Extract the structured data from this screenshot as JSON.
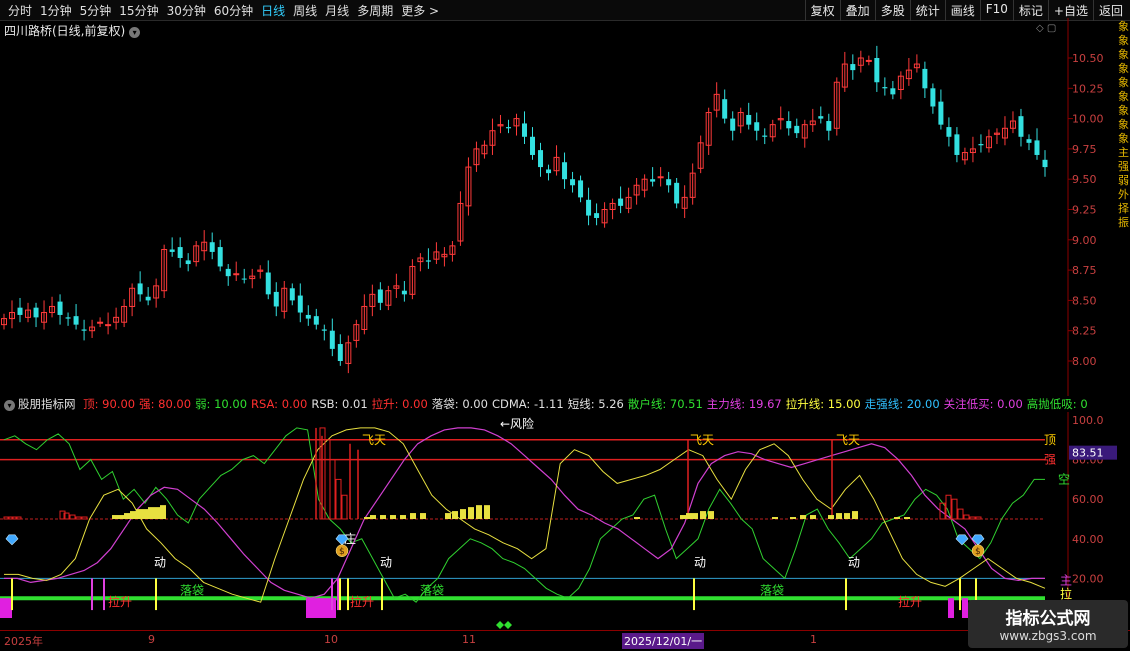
{
  "toolbar": {
    "periods": [
      "分时",
      "1分钟",
      "5分钟",
      "15分钟",
      "30分钟",
      "60分钟",
      "日线",
      "周线",
      "月线",
      "多周期",
      "更多 >"
    ],
    "active_period": "日线",
    "actions": [
      "复权",
      "叠加",
      "多股",
      "统计",
      "画线",
      "F10",
      "标记",
      "+自选",
      "返回"
    ]
  },
  "stock": {
    "name": "四川路桥(日线,前复权)"
  },
  "price_axis": {
    "labels": [
      "10.50",
      "10.25",
      "10.00",
      "9.75",
      "9.50",
      "9.25",
      "9.00",
      "8.75",
      "8.50",
      "8.25",
      "8.00"
    ]
  },
  "indicator": {
    "name": "股朋指标网",
    "fields": [
      {
        "label": "顶:",
        "value": "90.00",
        "color": "#ff3030"
      },
      {
        "label": "强:",
        "value": "80.00",
        "color": "#ff3030"
      },
      {
        "label": "弱:",
        "value": "10.00",
        "color": "#30e030"
      },
      {
        "label": "RSA:",
        "value": "0.00",
        "color": "#ff3030"
      },
      {
        "label": "RSB:",
        "value": "0.01",
        "color": "#e0e0e0"
      },
      {
        "label": "拉升:",
        "value": "0.00",
        "color": "#ff3030"
      },
      {
        "label": "落袋:",
        "value": "0.00",
        "color": "#e0e0e0"
      },
      {
        "label": "CDMA:",
        "value": "-1.11",
        "color": "#e0e0e0"
      },
      {
        "label": "短线:",
        "value": "5.26",
        "color": "#e0e0e0"
      },
      {
        "label": "散户线:",
        "value": "70.51",
        "color": "#30e030"
      },
      {
        "label": "主力线:",
        "value": "19.67",
        "color": "#e040e0"
      },
      {
        "label": "拉升线:",
        "value": "15.00",
        "color": "#ffff40"
      },
      {
        "label": "走强线:",
        "value": "20.00",
        "color": "#30c0ff"
      },
      {
        "label": "关注低买:",
        "value": "0.00",
        "color": "#e040e0"
      },
      {
        "label": "高抛低吸:",
        "value": "0",
        "color": "#30e030"
      }
    ],
    "axis_labels": [
      "100.0",
      "80.00",
      "60.00",
      "40.00",
      "20.00"
    ],
    "current_value": "83.51",
    "line_labels": {
      "top": "顶",
      "strong": "强",
      "empty": "空",
      "main": "主",
      "pull": "拉"
    },
    "annotations": {
      "feitian": "飞天",
      "dong": "动",
      "luodai": "落袋",
      "lasheng": "拉升",
      "zhuang": "庄",
      "hint": "←风险"
    }
  },
  "time_axis": {
    "labels": [
      "2025年",
      "9",
      "10",
      "11",
      "2025/12/01/一",
      "1"
    ]
  },
  "watermark": {
    "title": "指标公式网",
    "url": "www.zbgs3.com"
  },
  "right_strip": "象象象象象象象象象主强弱外择振"
}
